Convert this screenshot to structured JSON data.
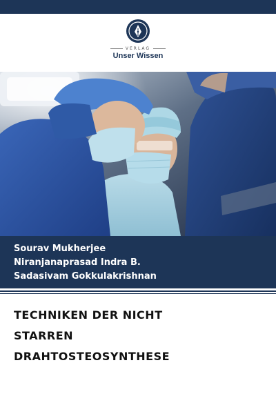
{
  "colors": {
    "brand_navy": "#1d3557",
    "title_text": "#111111",
    "author_text": "#ffffff"
  },
  "publisher": {
    "logo_icon": "pen-nib-icon",
    "label": "VERLAG",
    "name": "Unser Wissen"
  },
  "cover_image": {
    "subject": "surgeons-operating-room"
  },
  "authors": [
    "Sourav Mukherjee",
    "Niranjanaprasad Indra B.",
    "Sadasivam Gokkulakrishnan"
  ],
  "title_lines": [
    "TECHNIKEN DER NICHT",
    "STARREN",
    "DRAHTOSTEOSYNTHESE"
  ]
}
